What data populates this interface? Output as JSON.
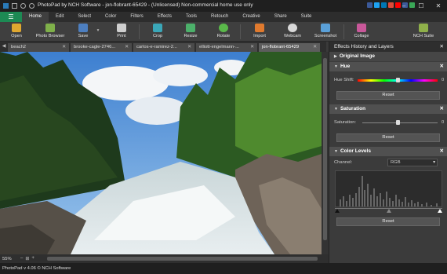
{
  "titlebar": {
    "title": "PhotoPad by NCH Software - jon-flobrant-65429 - (Unlicensed) Non-commercial home use only",
    "social_colors": [
      "#3b5998",
      "#1da1f2",
      "#0077b5",
      "#dd4b39",
      "#ff0000",
      "#3b5998",
      "#3aa757"
    ]
  },
  "menu": {
    "items": [
      "Home",
      "Edit",
      "Select",
      "Color",
      "Filters",
      "Effects",
      "Tools",
      "Retouch",
      "Creative",
      "Share",
      "Suite"
    ],
    "active": "Home"
  },
  "toolbar": {
    "open": "Open",
    "photo_browser": "Photo Browser",
    "save": "Save",
    "print": "Print",
    "crop": "Crop",
    "resize": "Resize",
    "rotate": "Rotate",
    "import": "Import",
    "webcam": "Webcam",
    "screenshot": "Screenshot",
    "collage": "Collage",
    "nch_suite": "NCH Suite"
  },
  "tabs": {
    "items": [
      "beach2",
      "brooke-cagle-2746...",
      "carlos-e-ramirez-2...",
      "elliott-engelmann-...",
      "jon-flobrant-65429"
    ],
    "active_index": 4
  },
  "status": {
    "zoom": "55%",
    "footer": "PhotoPad v 4.06 © NCH Software"
  },
  "panel": {
    "title": "Effects History and Layers",
    "original_image": "Original Image",
    "hue": {
      "title": "Hue",
      "label": "Hue Shift:",
      "value": "0",
      "reset": "Reset"
    },
    "saturation": {
      "title": "Saturation",
      "label": "Saturation:",
      "value": "0",
      "reset": "Reset"
    },
    "color_levels": {
      "title": "Color Levels",
      "channel_label": "Channel:",
      "channel_value": "RGB",
      "reset": "Reset"
    }
  }
}
